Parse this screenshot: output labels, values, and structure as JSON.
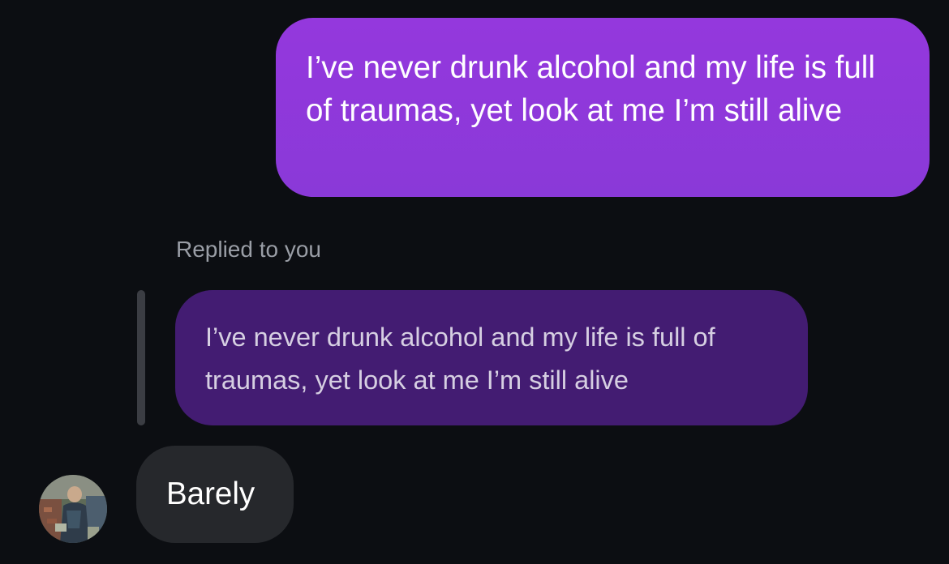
{
  "messages": {
    "sent": {
      "text": "I’ve never drunk alcohol and my life is full of traumas, yet look at me I’m still alive"
    },
    "reply": {
      "label": "Replied to you",
      "quoted_text": "I’ve never drunk alcohol and my life is full of traumas, yet look at me I’m still alive"
    },
    "received": {
      "text": "Barely"
    }
  },
  "colors": {
    "background": "#0c0e12",
    "sent_bubble": "#9438dd",
    "quoted_bubble": "#431c72",
    "received_bubble": "#26282c",
    "reply_label": "#9a9ea6"
  }
}
